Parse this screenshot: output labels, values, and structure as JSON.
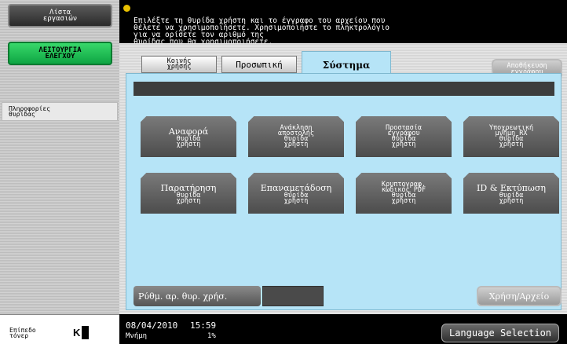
{
  "sidebar": {
    "job_list_label": "Λίστα\nεργασιών",
    "utility_label": "ΛΕΙΤΟΥΡΓΙΑ\nΕΛΕΓΧΟΥ",
    "box_info_label": "Πληροφορίες\nθυρίδας",
    "toner_label": "Επίπεδο\nτόνερ",
    "toner_color": "K"
  },
  "message": "Επιλέξτε τη θυρίδα χρήστη και το έγγραφο του αρχείου που\nθέλετε να χρησιμοποιήσετε. Χρησιμοποιήστε το πληκτρολόγιο\nγια να ορίσετε τον αριθμό της\nθυρίδας που θα χρησιμοποιήσετε.",
  "tabs": [
    {
      "label": "Κοινής\nχρήσης"
    },
    {
      "label": "Προσωπική"
    },
    {
      "label": "Σύστημα"
    }
  ],
  "save_document_label": "Αποθήκευση\nεγγράφου",
  "boxes": [
    {
      "title": "Αναφορά",
      "sub": "θυρίδα\nχρήστη"
    },
    {
      "title": "",
      "sub": "Ανάκληση\nαποστολής\nθυρίδα\nχρήστη"
    },
    {
      "title": "",
      "sub": "Προστασία\nεγγράφου\nθυρίδα\nχρήστη"
    },
    {
      "title": "",
      "sub": "Υποχρεωτική\nμνήμη RX\nθυρίδα\nχρήστη"
    },
    {
      "title": "Παρατήρηση",
      "sub": "θυρίδα\nχρήστη"
    },
    {
      "title": "Επαναμετάδοση",
      "sub": "θυρίδα\nχρήστη"
    },
    {
      "title": "",
      "sub": "Κρυπτογραφ.\nκωδικός PDF\nθυρίδα\nχρήστη"
    },
    {
      "title": "ID & Εκτύπωση",
      "sub": "θυρίδα\nχρήστη"
    }
  ],
  "box_number_label": "Ρύθμ. αρ. θυρ. χρήσ.",
  "use_file_label": "Χρήση/Αρχείο",
  "status": {
    "date": "08/04/2010",
    "time": "15:59",
    "memory_label": "Μνήμη",
    "memory_value": "1%",
    "language_button": "Language Selection"
  },
  "colors": {
    "tab_active": "#b6e4f7",
    "utility_green": "#1fc050",
    "box_button": "#5e5e5e"
  }
}
